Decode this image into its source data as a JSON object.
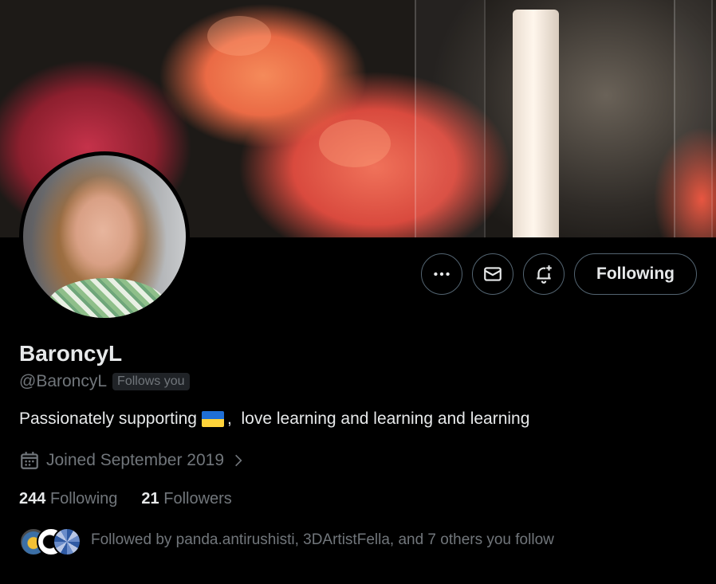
{
  "profile": {
    "display_name": "BaroncyL",
    "handle": "@BaroncyL",
    "follows_you_badge": "Follows you",
    "bio_before_flag": "Passionately supporting",
    "bio_after_flag": ",  love learning and learning and learning",
    "joined": "Joined September 2019",
    "following_count": "244",
    "following_label": "Following",
    "followers_count": "21",
    "followers_label": "Followers",
    "followed_by_text": "Followed by panda.antirushisti, 3DArtistFella, and 7 others you follow"
  },
  "actions": {
    "more_icon": "ellipsis-icon",
    "message_icon": "envelope-icon",
    "notify_icon": "bell-plus-icon",
    "following_button_label": "Following"
  },
  "colors": {
    "background": "#000000",
    "primary_text": "#e7e9ea",
    "secondary_text": "#71767b",
    "border": "#536471",
    "badge_bg": "#202327",
    "flag_blue": "#1f6fd6",
    "flag_yellow": "#ffd43b"
  }
}
